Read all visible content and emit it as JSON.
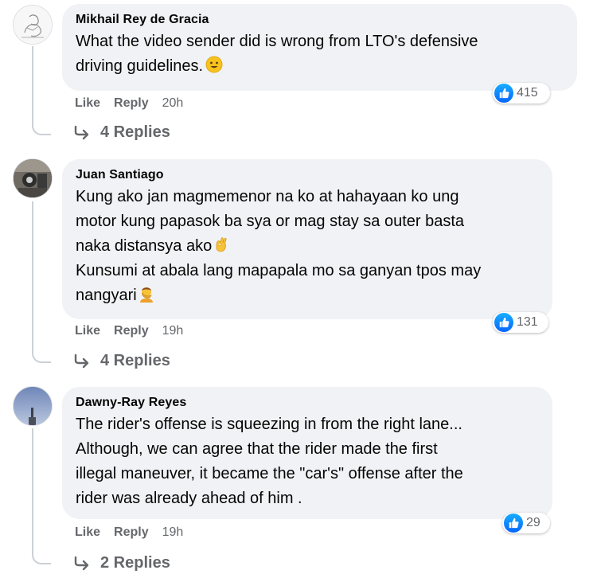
{
  "comments": [
    {
      "author": "Mikhail Rey de Gracia",
      "text": "What the video sender did is wrong from LTO's defensive\ndriving guidelines.",
      "emoji_icon": "smiling-face-icon",
      "reaction_count": "415",
      "like_label": "Like",
      "reply_label": "Reply",
      "time": "20h",
      "replies_label": "4 Replies"
    },
    {
      "author": "Juan Santiago",
      "text": "Kung ako jan magmemenor na ko at hahayaan ko ung\nmotor kung papasok ba sya or mag stay sa outer basta\nnaka distansya ako",
      "text2": "Kunsumi at abala lang mapapala mo sa ganyan tpos may\nnangyari",
      "emoji_icon": "ok-hand-icon",
      "emoji2_icon": "person-facepalming-icon",
      "reaction_count": "131",
      "like_label": "Like",
      "reply_label": "Reply",
      "time": "19h",
      "replies_label": "4 Replies"
    },
    {
      "author": "Dawny-Ray Reyes",
      "text": "The rider's offense is squeezing in from the right lane...\nAlthough, we can agree that the rider made the first\nillegal maneuver, it became the \"car's\" offense after the\nrider was already ahead of him .",
      "reaction_count": "29",
      "like_label": "Like",
      "reply_label": "Reply",
      "time": "19h",
      "replies_label": "2 Replies"
    }
  ],
  "colors": {
    "bubble": "#f0f2f5",
    "secondary_text": "#65676b",
    "like_blue": "#0866ff"
  }
}
